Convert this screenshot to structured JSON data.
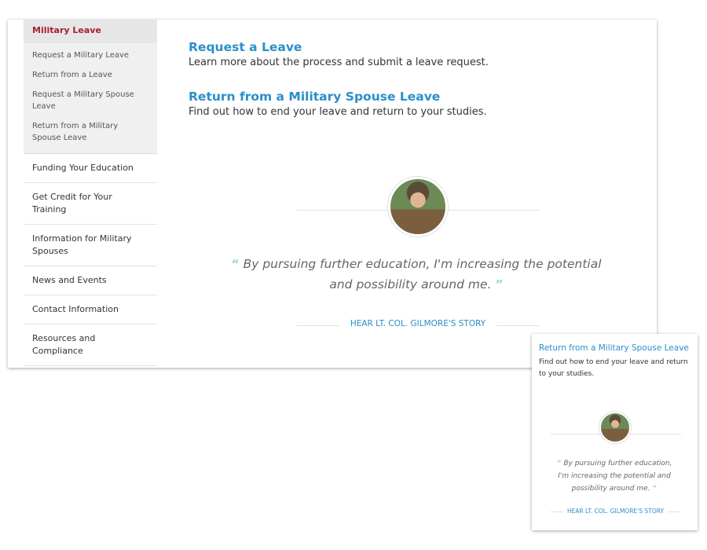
{
  "sidebar": {
    "header": "Military Leave",
    "sub_items": [
      "Request a Military Leave",
      "Return from a Leave",
      "Request a Military Spouse Leave",
      "Return from a Military Spouse Leave"
    ],
    "items": [
      "Funding Your Education",
      "Get Credit for Your Training",
      "Information for Military Spouses",
      "News and Events",
      "Contact Information",
      "Resources and Compliance"
    ]
  },
  "main": {
    "sections": [
      {
        "title": "Request a Leave",
        "desc": "Learn more about the process and submit a leave request."
      },
      {
        "title": "Return from a Military Spouse Leave",
        "desc": "Find out how to end your leave and return to your studies."
      }
    ],
    "quote": "By pursuing further education, I'm increasing the potential and possibility around me.",
    "open_quote": "“",
    "close_quote": "”",
    "story_link": "Hear Lt. Col. Gilmore's Story"
  },
  "mobile": {
    "title": "Return from a Military Spouse Leave",
    "desc": "Find out how to end your leave and return to your studies.",
    "quote": "By pursuing further education, I'm increasing the potential and possibility around me.",
    "story_link": "Hear Lt. Col. Gilmore's Story"
  },
  "colors": {
    "accent": "#2b8fc8",
    "active": "#a8202f",
    "quote_mark": "#9fd3c8"
  }
}
